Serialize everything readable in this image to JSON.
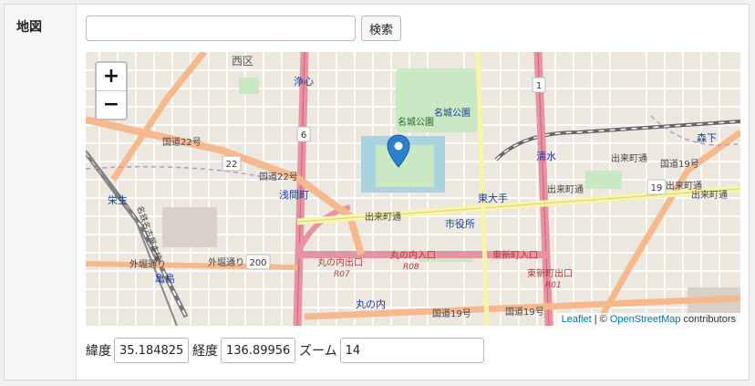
{
  "field_label": "地図",
  "search": {
    "placeholder": "",
    "value": "",
    "button_label": "検索"
  },
  "map": {
    "zoom_in": "+",
    "zoom_out": "−",
    "attribution": {
      "leaflet": "Leaflet",
      "separator": " | © ",
      "osm": "OpenStreetMap",
      "suffix": " contributors"
    },
    "labels": {
      "nishi_ku": "西区",
      "joshin": "浄心",
      "meijo_koen": "名城公園",
      "meijo_koen_station": "名城公園",
      "shimizu": "清水",
      "morishita": "森下",
      "sengen_cho": "浅間町",
      "higashi_ote": "東大手",
      "shiyakusho": "市役所",
      "demachi_dori": "出来町通",
      "demachi_dori2": "出来町通",
      "demachi_dori3": "出来町通",
      "demachi_dori4": "出来町通",
      "demachi_dori5": "出来町通",
      "kokudo22": "国道22号",
      "kokudo22b": "国道22号",
      "kokudo19": "国道19号",
      "kokudo19b": "国道19号",
      "kokudo19c": "国道19号",
      "sotobori_dori": "外堀通り",
      "sotobori_dori2": "外堀通り",
      "marunouchi_iriguchi": "丸の内入口",
      "marunouchi_deguchi": "丸の内出口",
      "higashi_shinmachi_iriguchi": "東新町入口",
      "higashi_shinmachi_deguchi": "東新町出口",
      "r07": "R07",
      "r08": "R08",
      "r01": "R01",
      "marunouchi": "丸の内",
      "kameshima": "亀島",
      "eisei": "栄生",
      "meiko_sen": "名鉄名古屋本線",
      "route6": "6",
      "route22": "22",
      "route19": "19",
      "route1": "1",
      "route200": "200"
    }
  },
  "coords": {
    "lat_label": "緯度",
    "lat_value": "35.1848250",
    "lng_label": "経度",
    "lng_value": "136.8995660",
    "zoom_label": "ズーム",
    "zoom_value": "14"
  }
}
